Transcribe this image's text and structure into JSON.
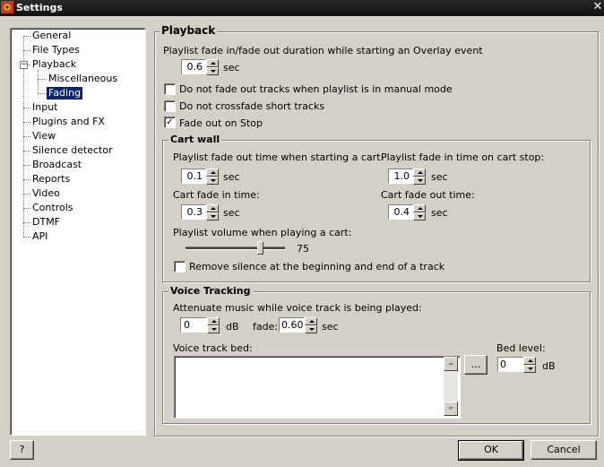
{
  "window": {
    "title": "Settings"
  },
  "tree": {
    "items": [
      {
        "label": "General"
      },
      {
        "label": "File Types"
      },
      {
        "label": "Playback"
      },
      {
        "label": "Miscellaneous"
      },
      {
        "label": "Fading"
      },
      {
        "label": "Input"
      },
      {
        "label": "Plugins and FX"
      },
      {
        "label": "View"
      },
      {
        "label": "Silence detector"
      },
      {
        "label": "Broadcast"
      },
      {
        "label": "Reports"
      },
      {
        "label": "Video"
      },
      {
        "label": "Controls"
      },
      {
        "label": "DTMF"
      },
      {
        "label": "API"
      }
    ],
    "selected": "Fading"
  },
  "playback": {
    "title": "Playback",
    "overlay_label": "Playlist fade in/fade out duration while starting an Overlay event",
    "overlay_value": "0.6",
    "overlay_unit": "sec",
    "manual_mode": {
      "label": "Do not fade out tracks when playlist is in manual mode",
      "checked": false
    },
    "crossfade_short": {
      "label": "Do not crossfade short tracks",
      "checked": false
    },
    "fade_on_stop": {
      "label": "Fade out on Stop",
      "checked": true
    }
  },
  "cartwall": {
    "title": "Cart wall",
    "fade_out_start_label": "Playlist fade out time when starting a cart:",
    "fade_out_start_value": "0.1",
    "fade_in_stop_label": "Playlist fade in time on cart stop:",
    "fade_in_stop_value": "1.0",
    "cart_fade_in_label": "Cart fade in time:",
    "cart_fade_in_value": "0.3",
    "cart_fade_out_label": "Cart fade out time:",
    "cart_fade_out_value": "0.4",
    "unit": "sec",
    "volume_label": "Playlist volume when playing a cart:",
    "volume_value": "75",
    "volume_level": 0.75,
    "remove_silence": {
      "label": "Remove silence at the beginning and end of a track",
      "checked": false
    }
  },
  "voice": {
    "title": "Voice Tracking",
    "attenuate_label": "Attenuate music while voice track is being played:",
    "attenuate_value": "0",
    "attenuate_unit": "dB",
    "fade_label": "fade:",
    "fade_value": "0.60",
    "fade_unit": "sec",
    "bed_label": "Voice track bed:",
    "bed_value": "",
    "browse_label": "...",
    "bed_level_label": "Bed level:",
    "bed_level_value": "0",
    "bed_level_unit": "dB"
  },
  "footer": {
    "help_label": "?",
    "ok_label": "OK",
    "cancel_label": "Cancel"
  },
  "colors": {
    "selection": "#0a246a",
    "face": "#d4d0c8"
  }
}
